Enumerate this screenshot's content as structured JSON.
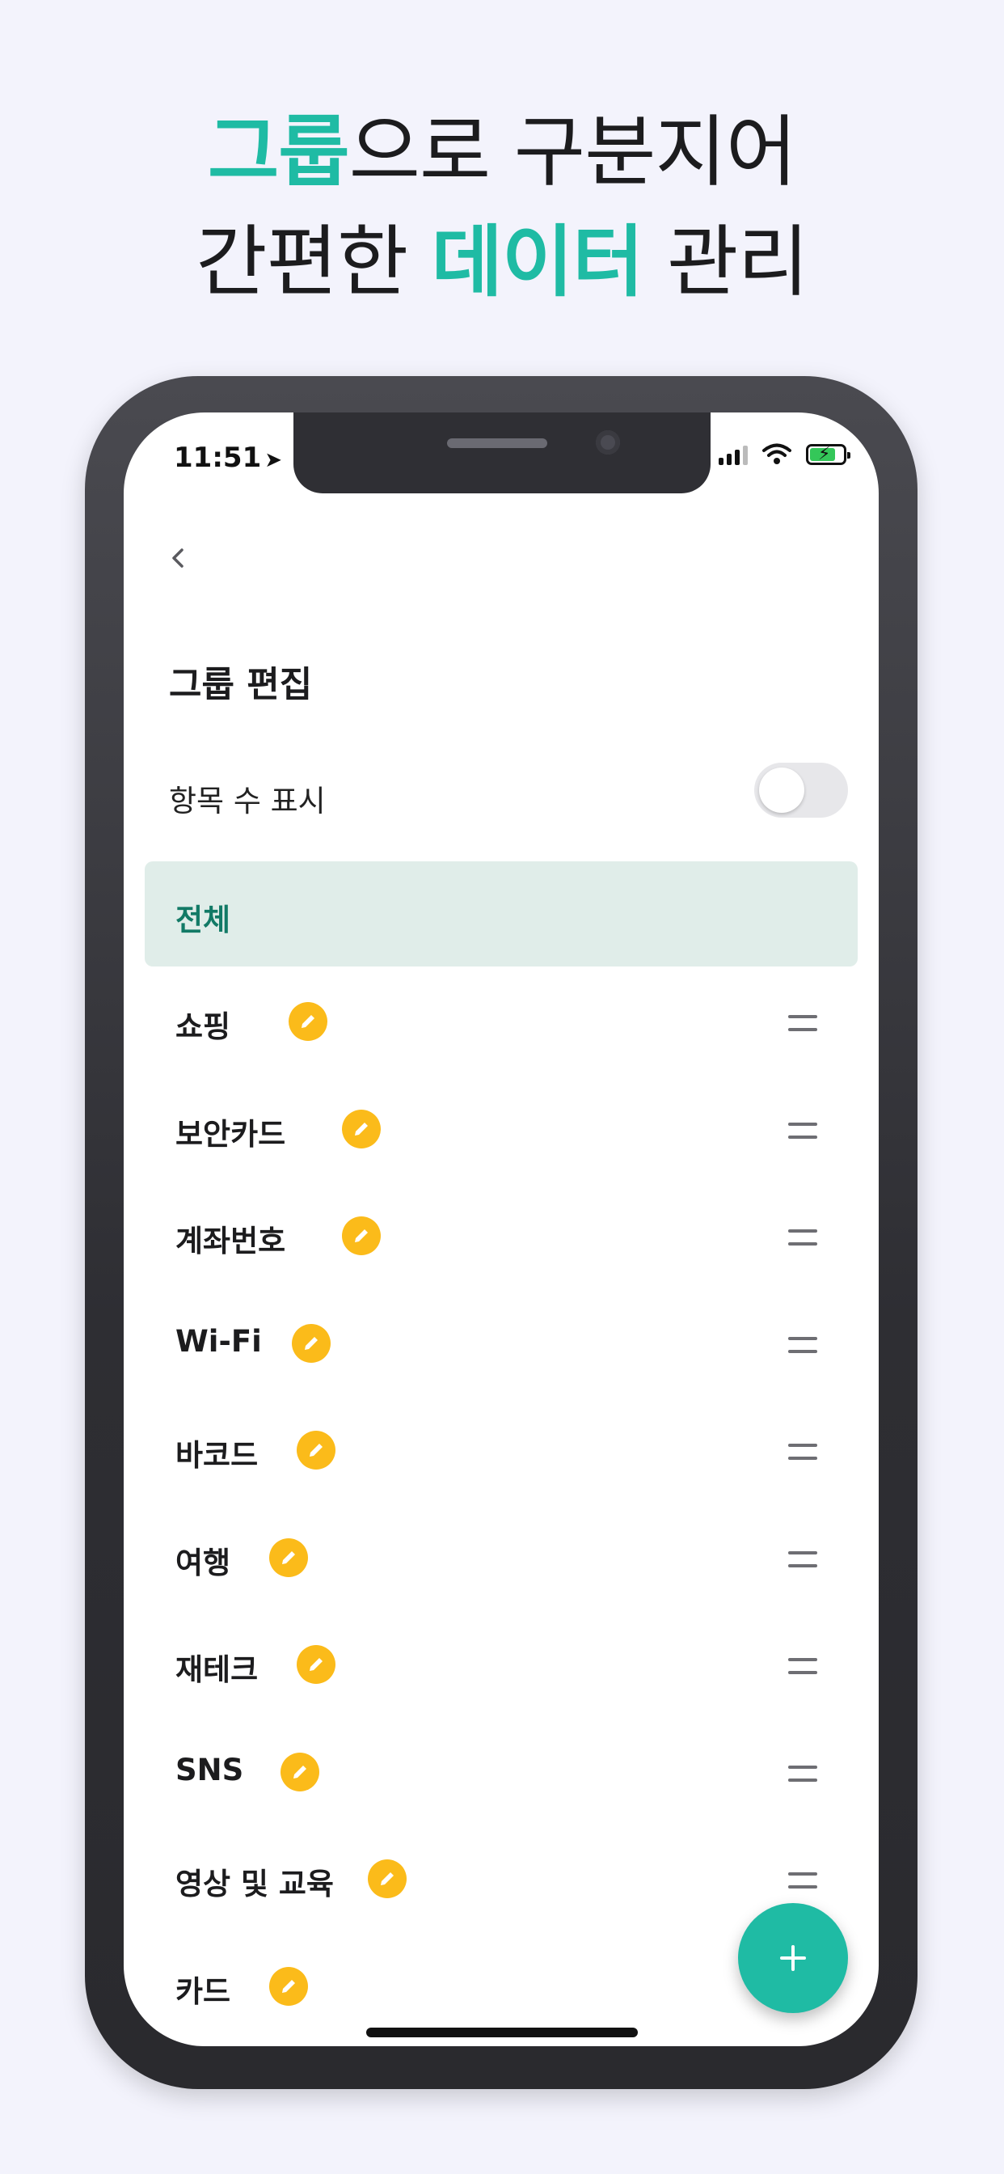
{
  "headline": {
    "line1_accent": "그룹",
    "line1_rest": "으로 구분지어",
    "line2_start": "간편한 ",
    "line2_accent": "데이터",
    "line2_end": " 관리"
  },
  "status_bar": {
    "time": "11:51"
  },
  "screen": {
    "title": "그룹 편집",
    "count_toggle_label": "항목 수 표시",
    "count_toggle_on": false,
    "all_group_label": "전체"
  },
  "groups": [
    {
      "label": "쇼핑"
    },
    {
      "label": "보안카드"
    },
    {
      "label": "계좌번호"
    },
    {
      "label": "Wi-Fi"
    },
    {
      "label": "바코드"
    },
    {
      "label": "여행"
    },
    {
      "label": "재테크"
    },
    {
      "label": "SNS"
    },
    {
      "label": "영상 및 교육"
    },
    {
      "label": "카드"
    }
  ],
  "icons": {
    "back": "chevron-left-icon",
    "edit": "pencil-icon",
    "reorder": "drag-handle-icon",
    "add": "plus-icon"
  },
  "colors": {
    "accent": "#1fbba4",
    "edit_badge": "#fbbb1a",
    "selected_row_bg": "#e0ede9",
    "selected_row_text": "#127a66",
    "background": "#f3f3fc"
  }
}
